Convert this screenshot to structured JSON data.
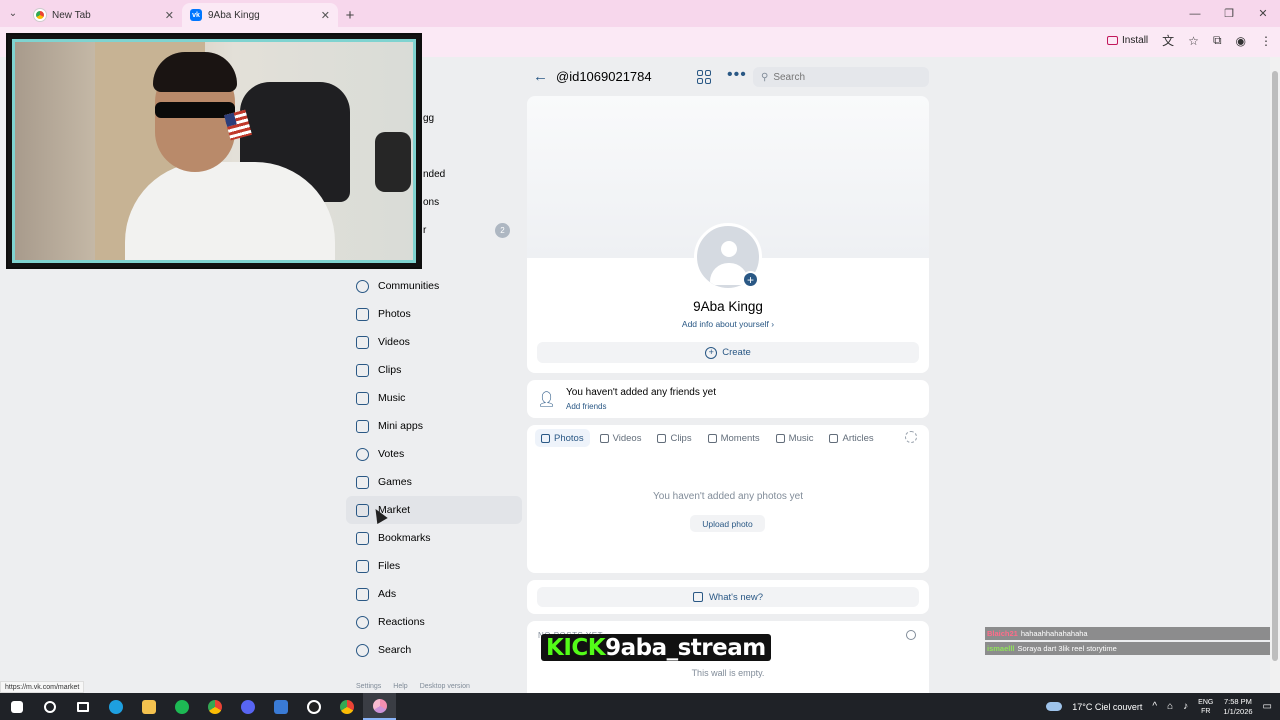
{
  "browser": {
    "tabs": [
      {
        "label": "New Tab",
        "active": false
      },
      {
        "label": "9Aba Kingg",
        "active": true
      }
    ],
    "install_label": "Install",
    "status_url": "https://m.vk.com/market"
  },
  "profile": {
    "handle": "@id1069021784",
    "name": "9Aba Kingg",
    "add_info": "Add info about yourself",
    "create_label": "Create",
    "avatar_add": "+"
  },
  "search": {
    "placeholder": "Search"
  },
  "nav": {
    "partial_items": [
      "gg",
      "nded",
      "ons",
      "r"
    ],
    "badge": "2",
    "items": [
      {
        "label": "Communities",
        "icon": "communities-icon"
      },
      {
        "label": "Photos",
        "icon": "photos-icon"
      },
      {
        "label": "Videos",
        "icon": "videos-icon"
      },
      {
        "label": "Clips",
        "icon": "clips-icon"
      },
      {
        "label": "Music",
        "icon": "music-icon"
      },
      {
        "label": "Mini apps",
        "icon": "mini-apps-icon"
      },
      {
        "label": "Votes",
        "icon": "votes-icon"
      },
      {
        "label": "Games",
        "icon": "games-icon"
      },
      {
        "label": "Market",
        "icon": "market-icon"
      },
      {
        "label": "Bookmarks",
        "icon": "bookmarks-icon"
      },
      {
        "label": "Files",
        "icon": "files-icon"
      },
      {
        "label": "Ads",
        "icon": "ads-icon"
      },
      {
        "label": "Reactions",
        "icon": "reactions-icon"
      },
      {
        "label": "Search",
        "icon": "search-icon"
      }
    ],
    "footer": [
      "Settings",
      "Help",
      "Desktop version"
    ]
  },
  "friends": {
    "text": "You haven't added any friends yet",
    "link": "Add friends"
  },
  "media": {
    "tabs": [
      "Photos",
      "Videos",
      "Clips",
      "Moments",
      "Music",
      "Articles"
    ],
    "active_tab": "Photos",
    "empty_text": "You haven't added any photos yet",
    "upload_label": "Upload photo"
  },
  "whats_new": {
    "label": "What's new?"
  },
  "wall": {
    "header": "NO POSTS YET",
    "empty": "This wall is empty."
  },
  "overlay": {
    "kick_prefix": "KICK",
    "kick_channel": "9aba_stream",
    "chat": [
      {
        "user": "Blaich21",
        "message": "hahaahhahahahaha"
      },
      {
        "user": "ismaelll",
        "message": "Soraya dart 3lik reel storytime"
      }
    ]
  },
  "taskbar": {
    "weather": "17°C  Ciel couvert",
    "lang_top": "ENG",
    "lang_bottom": "FR",
    "time": "7:58 PM",
    "date": "1/1/2026"
  },
  "colors": {
    "accent": "#2a5885",
    "tabbar": "#f7d7ec",
    "kick_green": "#53fc18"
  }
}
